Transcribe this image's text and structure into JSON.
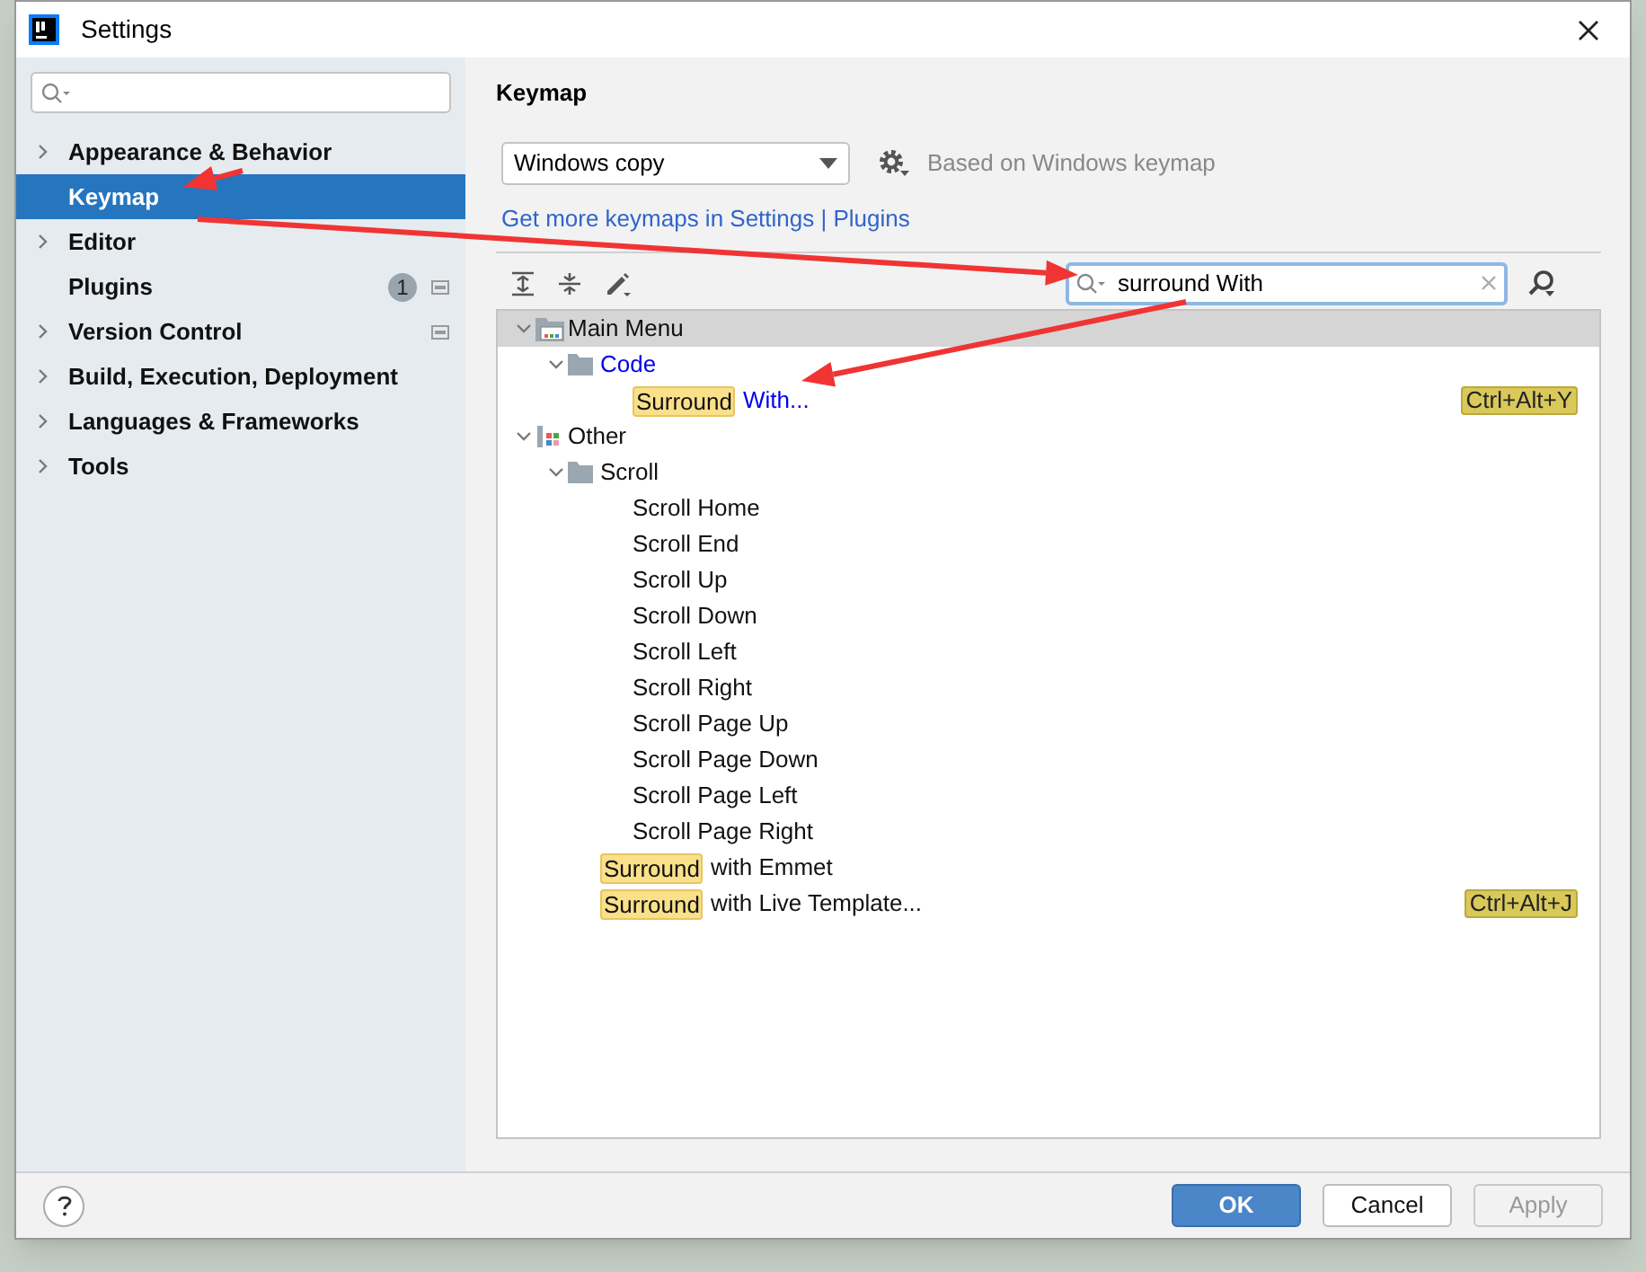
{
  "window": {
    "title": "Settings"
  },
  "sidebar": {
    "items": [
      {
        "label": "Appearance & Behavior",
        "expandable": true,
        "selected": false
      },
      {
        "label": "Keymap",
        "expandable": false,
        "selected": true
      },
      {
        "label": "Editor",
        "expandable": true,
        "selected": false
      },
      {
        "label": "Plugins",
        "expandable": false,
        "selected": false,
        "badge": "1",
        "project_icon": true
      },
      {
        "label": "Version Control",
        "expandable": true,
        "selected": false,
        "project_icon": true
      },
      {
        "label": "Build, Execution, Deployment",
        "expandable": true,
        "selected": false
      },
      {
        "label": "Languages & Frameworks",
        "expandable": true,
        "selected": false
      },
      {
        "label": "Tools",
        "expandable": true,
        "selected": false
      }
    ]
  },
  "panel": {
    "title": "Keymap",
    "keymap": "Windows copy",
    "based_on": "Based on Windows keymap",
    "link": "Get more keymaps in Settings | Plugins",
    "search": {
      "value": "surround With"
    },
    "tree": [
      {
        "kind": "group",
        "label": "Main Menu",
        "expanded": true,
        "selected": true,
        "modified": false,
        "children": [
          {
            "kind": "folder",
            "label": "Code",
            "expanded": true,
            "selected": false,
            "modified": true,
            "children": [
              {
                "kind": "action",
                "match": "Surround",
                "label": "With...",
                "shortcut": "Ctrl+Alt+Y",
                "selected": false,
                "modified": true
              }
            ]
          }
        ]
      },
      {
        "kind": "other",
        "label": "Other",
        "expanded": true,
        "selected": false,
        "modified": false,
        "children": [
          {
            "kind": "folder",
            "label": "Scroll",
            "expanded": true,
            "selected": false,
            "modified": false,
            "children": [
              {
                "kind": "action",
                "label": "Scroll Home",
                "selected": false,
                "modified": false
              },
              {
                "kind": "action",
                "label": "Scroll End",
                "selected": false,
                "modified": false
              },
              {
                "kind": "action",
                "label": "Scroll Up",
                "selected": false,
                "modified": false
              },
              {
                "kind": "action",
                "label": "Scroll Down",
                "selected": false,
                "modified": false
              },
              {
                "kind": "action",
                "label": "Scroll Left",
                "selected": false,
                "modified": false
              },
              {
                "kind": "action",
                "label": "Scroll Right",
                "selected": false,
                "modified": false
              },
              {
                "kind": "action",
                "label": "Scroll Page Up",
                "selected": false,
                "modified": false
              },
              {
                "kind": "action",
                "label": "Scroll Page Down",
                "selected": false,
                "modified": false
              },
              {
                "kind": "action",
                "label": "Scroll Page Left",
                "selected": false,
                "modified": false
              },
              {
                "kind": "action",
                "label": "Scroll Page Right",
                "selected": false,
                "modified": false
              }
            ]
          },
          {
            "kind": "action",
            "match": "Surround",
            "label": "with Emmet",
            "selected": false,
            "modified": false
          },
          {
            "kind": "action",
            "match": "Surround",
            "label": "with Live Template...",
            "shortcut": "Ctrl+Alt+J",
            "selected": false,
            "modified": false
          }
        ]
      }
    ]
  },
  "buttons": [
    {
      "label": "OK",
      "kind": "primary",
      "disabled": false
    },
    {
      "label": "Cancel",
      "kind": "normal",
      "disabled": false
    },
    {
      "label": "Apply",
      "kind": "normal",
      "disabled": true
    }
  ]
}
